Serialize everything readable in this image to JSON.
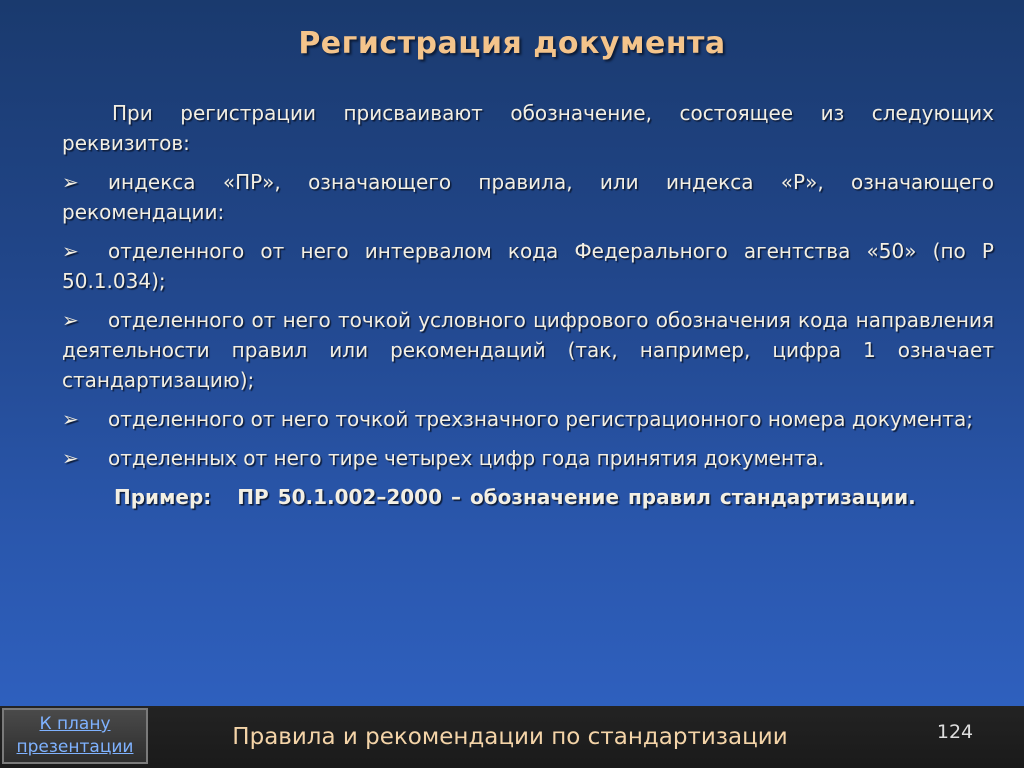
{
  "slide": {
    "title": "Регистрация документа",
    "intro": "При регистрации присваивают обозначение, состоящее из следующих реквизитов:",
    "bullet_icon": "arrow-right-icon",
    "bullet_glyph": "➢",
    "bullets": [
      "индекса «ПР», означающего правила, или индекса «Р», означающего рекомендации:",
      "отделенного от него интервалом кода Федерального агентства «50» (по Р 50.1.034);",
      "отделенного от него точкой условного цифрового обозначения кода направления деятельности правил или рекомендаций (так, например, цифра 1 означает стандартизацию);",
      "отделенного от него точкой трехзначного регистрационного номера документа;",
      "отделенных от него тире четырех цифр года принятия документа."
    ],
    "example_label": "Пример:",
    "example_text": "ПР 50.1.002–2000 – обозначение правил стандартизации."
  },
  "footer": {
    "plan_button_line1": "К плану",
    "plan_button_line2": "презентации",
    "title": "Правила и рекомендации  по стандартизации",
    "page_number": "124"
  },
  "colors": {
    "title": "#f4c48b",
    "body_text": "#f3efe3",
    "link": "#7fb2ff",
    "footer_bg": "#1e1e1e"
  }
}
